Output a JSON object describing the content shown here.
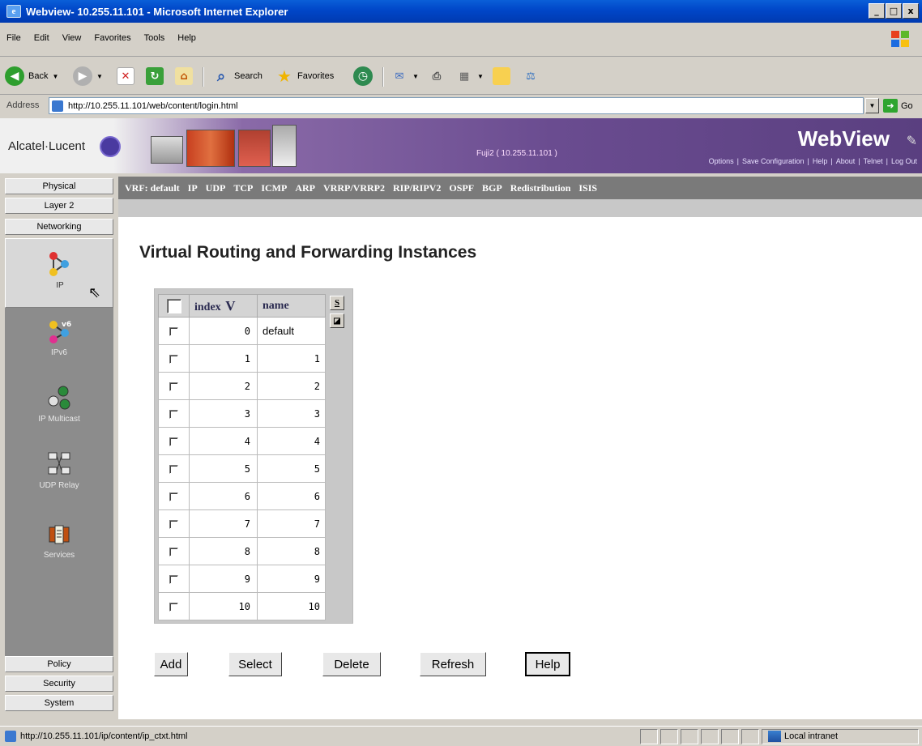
{
  "window": {
    "title": "Webview- 10.255.11.101 - Microsoft Internet Explorer",
    "controls": [
      "_",
      "□",
      "x"
    ]
  },
  "menu": [
    "File",
    "Edit",
    "View",
    "Favorites",
    "Tools",
    "Help"
  ],
  "toolbar": {
    "back": "Back",
    "search": "Search",
    "favorites": "Favorites"
  },
  "address": {
    "label": "Address",
    "url": "http://10.255.11.101/web/content/login.html",
    "go": "Go"
  },
  "header": {
    "brand": "Alcatel·Lucent",
    "app_title": "WebView",
    "device": "Fuji2 ( 10.255.11.101 )",
    "links": [
      "Options",
      "|",
      "Save Configuration",
      "|",
      "Help",
      "|",
      "About",
      "|",
      "Telnet",
      "|",
      "Log Out"
    ]
  },
  "nav": {
    "top": [
      "Physical",
      "Layer 2",
      "Networking"
    ],
    "items": [
      {
        "label": "IP",
        "icon": "ip-icon"
      },
      {
        "label": "IPv6",
        "icon": "ipv6-icon"
      },
      {
        "label": "IP Multicast",
        "icon": "ip-multicast-icon"
      },
      {
        "label": "UDP Relay",
        "icon": "udp-relay-icon"
      },
      {
        "label": "Services",
        "icon": "services-icon"
      }
    ],
    "bottom": [
      "Policy",
      "Security",
      "System"
    ]
  },
  "tabs": [
    "VRF: default",
    "IP",
    "UDP",
    "TCP",
    "ICMP",
    "ARP",
    "VRRP/VRRP2",
    "RIP/RIPV2",
    "OSPF",
    "BGP",
    "Redistribution",
    "ISIS"
  ],
  "page": {
    "title": "Virtual Routing and Forwarding Instances"
  },
  "table": {
    "columns": [
      "index",
      "name"
    ],
    "sort_indicator": "V",
    "side_button": "S",
    "rows": [
      {
        "index": "0",
        "name": "default"
      },
      {
        "index": "1",
        "name": "1"
      },
      {
        "index": "2",
        "name": "2"
      },
      {
        "index": "3",
        "name": "3"
      },
      {
        "index": "4",
        "name": "4"
      },
      {
        "index": "5",
        "name": "5"
      },
      {
        "index": "6",
        "name": "6"
      },
      {
        "index": "7",
        "name": "7"
      },
      {
        "index": "8",
        "name": "8"
      },
      {
        "index": "9",
        "name": "9"
      },
      {
        "index": "10",
        "name": "10"
      }
    ]
  },
  "actions": [
    "Add",
    "Select",
    "Delete",
    "Refresh",
    "Help"
  ],
  "status": {
    "url": "http://10.255.11.101/ip/content/ip_ctxt.html",
    "zone": "Local intranet"
  }
}
